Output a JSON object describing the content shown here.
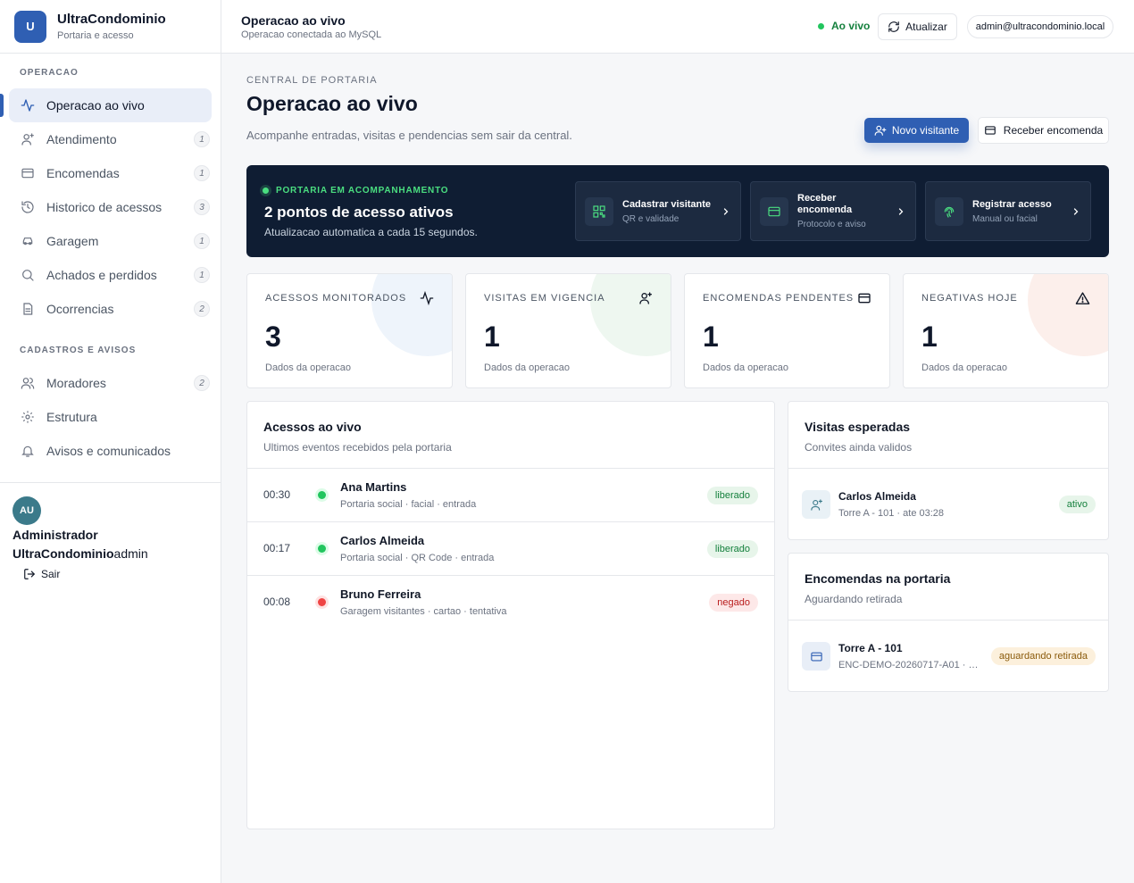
{
  "brand": {
    "logo_letter": "U",
    "name": "UltraCondominio",
    "subtitle": "Portaria e acesso"
  },
  "sidebar": {
    "section_operacao": "OPERACAO",
    "section_cadastros": "CADASTROS E AVISOS",
    "items": [
      {
        "label": "Operacao ao vivo",
        "icon": "activity-icon",
        "badge": ""
      },
      {
        "label": "Atendimento",
        "icon": "user-plus-icon",
        "badge": "1"
      },
      {
        "label": "Encomendas",
        "icon": "card-icon",
        "badge": "1"
      },
      {
        "label": "Historico de acessos",
        "icon": "history-icon",
        "badge": "3"
      },
      {
        "label": "Garagem",
        "icon": "car-icon",
        "badge": "1"
      },
      {
        "label": "Achados e perdidos",
        "icon": "search-icon",
        "badge": "1"
      },
      {
        "label": "Ocorrencias",
        "icon": "document-icon",
        "badge": "2"
      },
      {
        "label": "Moradores",
        "icon": "users-icon",
        "badge": "2"
      },
      {
        "label": "Estrutura",
        "icon": "gear-icon",
        "badge": ""
      },
      {
        "label": "Avisos e comunicados",
        "icon": "bell-icon",
        "badge": ""
      }
    ],
    "user": {
      "initials": "AU",
      "name": "Administrador UltraCondominio",
      "role": "admin",
      "logout_label": "Sair"
    }
  },
  "topbar": {
    "title": "Operacao ao vivo",
    "subtitle": "Operacao conectada ao MySQL",
    "live_label": "Ao vivo",
    "refresh_label": "Atualizar",
    "user_email": "admin@ultracondominio.local"
  },
  "header": {
    "eyebrow": "CENTRAL DE PORTARIA",
    "title": "Operacao ao vivo",
    "description": "Acompanhe entradas, visitas e pendencias sem sair da central.",
    "primary_button": "Novo visitante",
    "secondary_button": "Receber encomenda"
  },
  "banner": {
    "tag": "PORTARIA EM ACOMPANHAMENTO",
    "title": "2 pontos de acesso ativos",
    "subtitle": "Atualizacao automatica a cada 15 segundos.",
    "actions": [
      {
        "title": "Cadastrar visitante",
        "subtitle": "QR e validade"
      },
      {
        "title": "Receber encomenda",
        "subtitle": "Protocolo e aviso"
      },
      {
        "title": "Registrar acesso",
        "subtitle": "Manual ou facial"
      }
    ]
  },
  "stats": [
    {
      "label": "ACESSOS MONITORADOS",
      "value": "3",
      "footer": "Dados da operacao",
      "icon": "activity-icon",
      "color": "#eef4fb"
    },
    {
      "label": "VISITAS EM VIGENCIA",
      "value": "1",
      "footer": "Dados da operacao",
      "icon": "user-plus-icon",
      "color": "#eef7f0"
    },
    {
      "label": "ENCOMENDAS PENDENTES",
      "value": "1",
      "footer": "Dados da operacao",
      "icon": "card-icon",
      "color": "#ffffff"
    },
    {
      "label": "NEGATIVAS HOJE",
      "value": "1",
      "footer": "Dados da operacao",
      "icon": "warning-icon",
      "color": "#fcefeb"
    }
  ],
  "live_access": {
    "title": "Acessos ao vivo",
    "subtitle": "Ultimos eventos recebidos pela portaria",
    "rows": [
      {
        "time": "00:30",
        "name": "Ana Martins",
        "meta": "Portaria social · facial · entrada",
        "status": "liberado",
        "status_color": "#22c55e"
      },
      {
        "time": "00:17",
        "name": "Carlos Almeida",
        "meta": "Portaria social · QR Code · entrada",
        "status": "liberado",
        "status_color": "#22c55e"
      },
      {
        "time": "00:08",
        "name": "Bruno Ferreira",
        "meta": "Garagem visitantes · cartao · tentativa",
        "status": "negado",
        "status_color": "#ef4444"
      }
    ]
  },
  "expected_visits": {
    "title": "Visitas esperadas",
    "subtitle": "Convites ainda validos",
    "item": {
      "name": "Carlos Almeida",
      "meta": "Torre A - 101 · ate 03:28",
      "status": "ativo"
    }
  },
  "packages": {
    "title": "Encomendas na portaria",
    "subtitle": "Aguardando retirada",
    "item": {
      "name": "Torre A - 101",
      "meta": "ENC-DEMO-20260717-A01 · Lo...",
      "status": "aguardando retirada"
    }
  }
}
